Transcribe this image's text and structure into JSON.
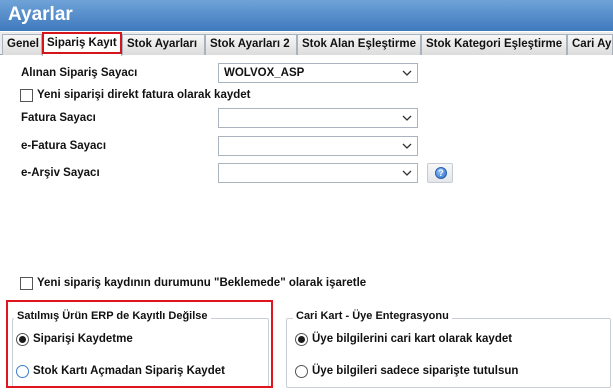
{
  "window": {
    "title": "Ayarlar"
  },
  "tabs": [
    {
      "label": "Genel"
    },
    {
      "label": "Sipariş Kayıt"
    },
    {
      "label": "Stok Ayarları"
    },
    {
      "label": "Stok Ayarları 2"
    },
    {
      "label": "Stok Alan Eşleştirme"
    },
    {
      "label": "Stok Kategori Eşleştirme"
    },
    {
      "label": "Cari Ay"
    }
  ],
  "form": {
    "alinan_siparis_sayaci": {
      "label": "Alınan Sipariş Sayacı",
      "value": "WOLVOX_ASP"
    },
    "direkt_fatura": {
      "label": "Yeni siparişi direkt fatura olarak kaydet",
      "checked": false
    },
    "fatura_sayaci": {
      "label": "Fatura Sayacı",
      "value": ""
    },
    "efatura_sayaci": {
      "label": "e-Fatura Sayacı",
      "value": ""
    },
    "earsiv_sayaci": {
      "label": "e-Arşiv Sayacı",
      "value": ""
    },
    "beklemede": {
      "label": "Yeni sipariş kaydının durumunu \"Beklemede\" olarak işaretle",
      "checked": false
    }
  },
  "group_left": {
    "title": "Satılmış Ürün ERP de Kayıtlı Değilse",
    "options": [
      {
        "label": "Siparişi Kaydetme",
        "selected": true
      },
      {
        "label": "Stok Kartı Açmadan Sipariş Kaydet",
        "selected": false
      }
    ]
  },
  "group_right": {
    "title": "Cari Kart - Üye Entegrasyonu",
    "options": [
      {
        "label": "Üye bilgilerini cari kart olarak kaydet",
        "selected": true
      },
      {
        "label": "Üye bilgileri sadece siparişte tutulsun",
        "selected": false
      }
    ]
  },
  "icons": {
    "chevron": "chevron-down-icon",
    "help": "help-icon",
    "help_glyph": "?"
  },
  "colors": {
    "title_bar": "#4f86c6",
    "highlight": "#e1151d"
  }
}
